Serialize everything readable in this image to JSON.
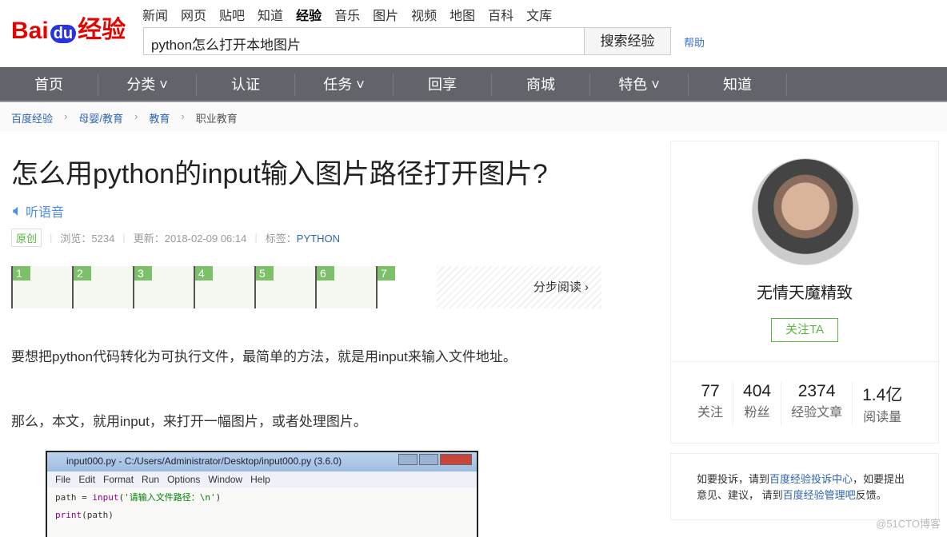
{
  "header": {
    "links": [
      "新闻",
      "网页",
      "贴吧",
      "知道",
      "经验",
      "音乐",
      "图片",
      "视频",
      "地图",
      "百科",
      "文库"
    ],
    "active": "经验",
    "logo": {
      "bai": "Bai",
      "du": "du",
      "jy": "经验"
    },
    "search_value": "python怎么打开本地图片",
    "search_button": "搜索经验",
    "help": "帮助"
  },
  "nav": [
    {
      "label": "首页"
    },
    {
      "label": "分类 ˅"
    },
    {
      "label": "认证"
    },
    {
      "label": "任务 ˅"
    },
    {
      "label": "回享"
    },
    {
      "label": "商城"
    },
    {
      "label": "特色 ˅"
    },
    {
      "label": "知道"
    }
  ],
  "breadcrumb": [
    "百度经验",
    "母婴/教育",
    "教育",
    "职业教育"
  ],
  "article": {
    "title": "怎么用python的input输入图片路径打开图片?",
    "listen": "听语音",
    "badge": "原创",
    "views": "浏览：5234",
    "updated": "更新：2018-02-09 06:14",
    "tag_label": "标签：",
    "tag": "PYTHON",
    "steps": [
      "1",
      "2",
      "3",
      "4",
      "5",
      "6",
      "7"
    ],
    "step_read": "分步阅读 ›",
    "para1": "要想把python代码转化为可执行文件，最简单的方法，就是用input来输入文件地址。",
    "para2": "那么，本文，就用input，来打开一幅图片，或者处理图片。",
    "screenshot": {
      "title": "input000.py - C:/Users/Administrator/Desktop/input000.py (3.6.0)",
      "menu": [
        "File",
        "Edit",
        "Format",
        "Run",
        "Options",
        "Window",
        "Help"
      ],
      "line1a": "path = ",
      "line1b": "input",
      "line1c": "(",
      "line1d": "'请输入文件路径：\\n'",
      "line1e": ")",
      "line2a": "print",
      "line2b": "(path)"
    }
  },
  "author": {
    "name": "无情天魔精致",
    "follow": "关注TA",
    "stats": [
      {
        "value": "77",
        "label": "关注"
      },
      {
        "value": "404",
        "label": "粉丝"
      },
      {
        "value": "2374",
        "label": "经验文章"
      },
      {
        "value": "1.4亿",
        "label": "阅读量"
      }
    ]
  },
  "notice": {
    "t1": "如要投诉，请到",
    "l1": "百度经验投诉中心",
    "t2": "，如要提出意见、建议， 请到",
    "l2": "百度经验管理吧",
    "t3": "反馈。"
  },
  "watermark": "@51CTO博客"
}
